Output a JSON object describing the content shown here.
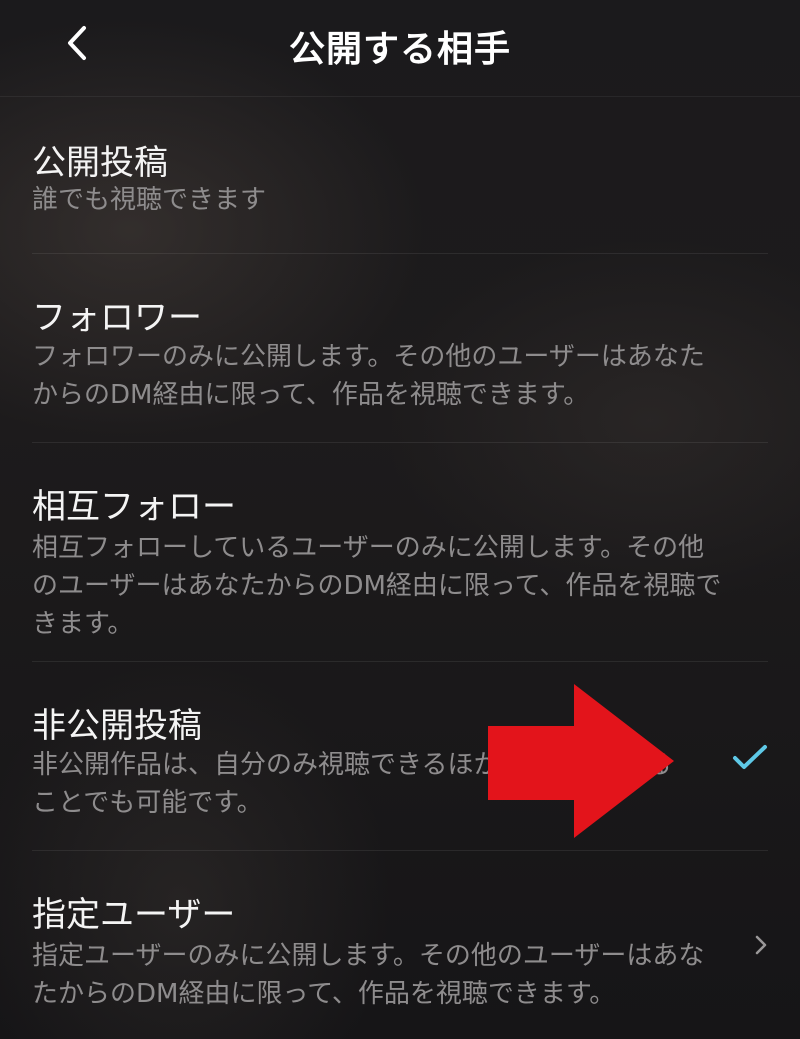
{
  "header": {
    "title": "公開する相手",
    "back_icon": "chevron-left-icon"
  },
  "options": [
    {
      "title": "公開投稿",
      "description": "誰でも視聴できます",
      "selected": false,
      "trailing_icon": null
    },
    {
      "title": "フォロワー",
      "description": "フォロワーのみに公開します。その他のユーザーはあなたからのDM経由に限って、作品を視聴できます。",
      "selected": false,
      "trailing_icon": null
    },
    {
      "title": "相互フォロー",
      "description": "相互フォローしているユーザーのみに公開します。その他のユーザーはあなたからのDM経由に限って、作品を視聴できます。",
      "selected": false,
      "trailing_icon": null
    },
    {
      "title": "非公開投稿",
      "description": "非公開作品は、自分のみ視聴できるほかDMで送信することでも可能です。",
      "selected": true,
      "trailing_icon": "check-icon"
    },
    {
      "title": "指定ユーザー",
      "description": "指定ユーザーのみに公開します。その他のユーザーはあなたからのDM経由に限って、作品を視聴できます。",
      "selected": false,
      "trailing_icon": "chevron-right-icon"
    }
  ],
  "colors": {
    "background": "#1b1a1c",
    "title_text": "#f4f4f4",
    "description_text": "#8e8c8d",
    "check_accent": "#5ec8e6",
    "annotation_arrow": "#e3141b"
  },
  "annotation": {
    "icon": "red-arrow-icon"
  }
}
